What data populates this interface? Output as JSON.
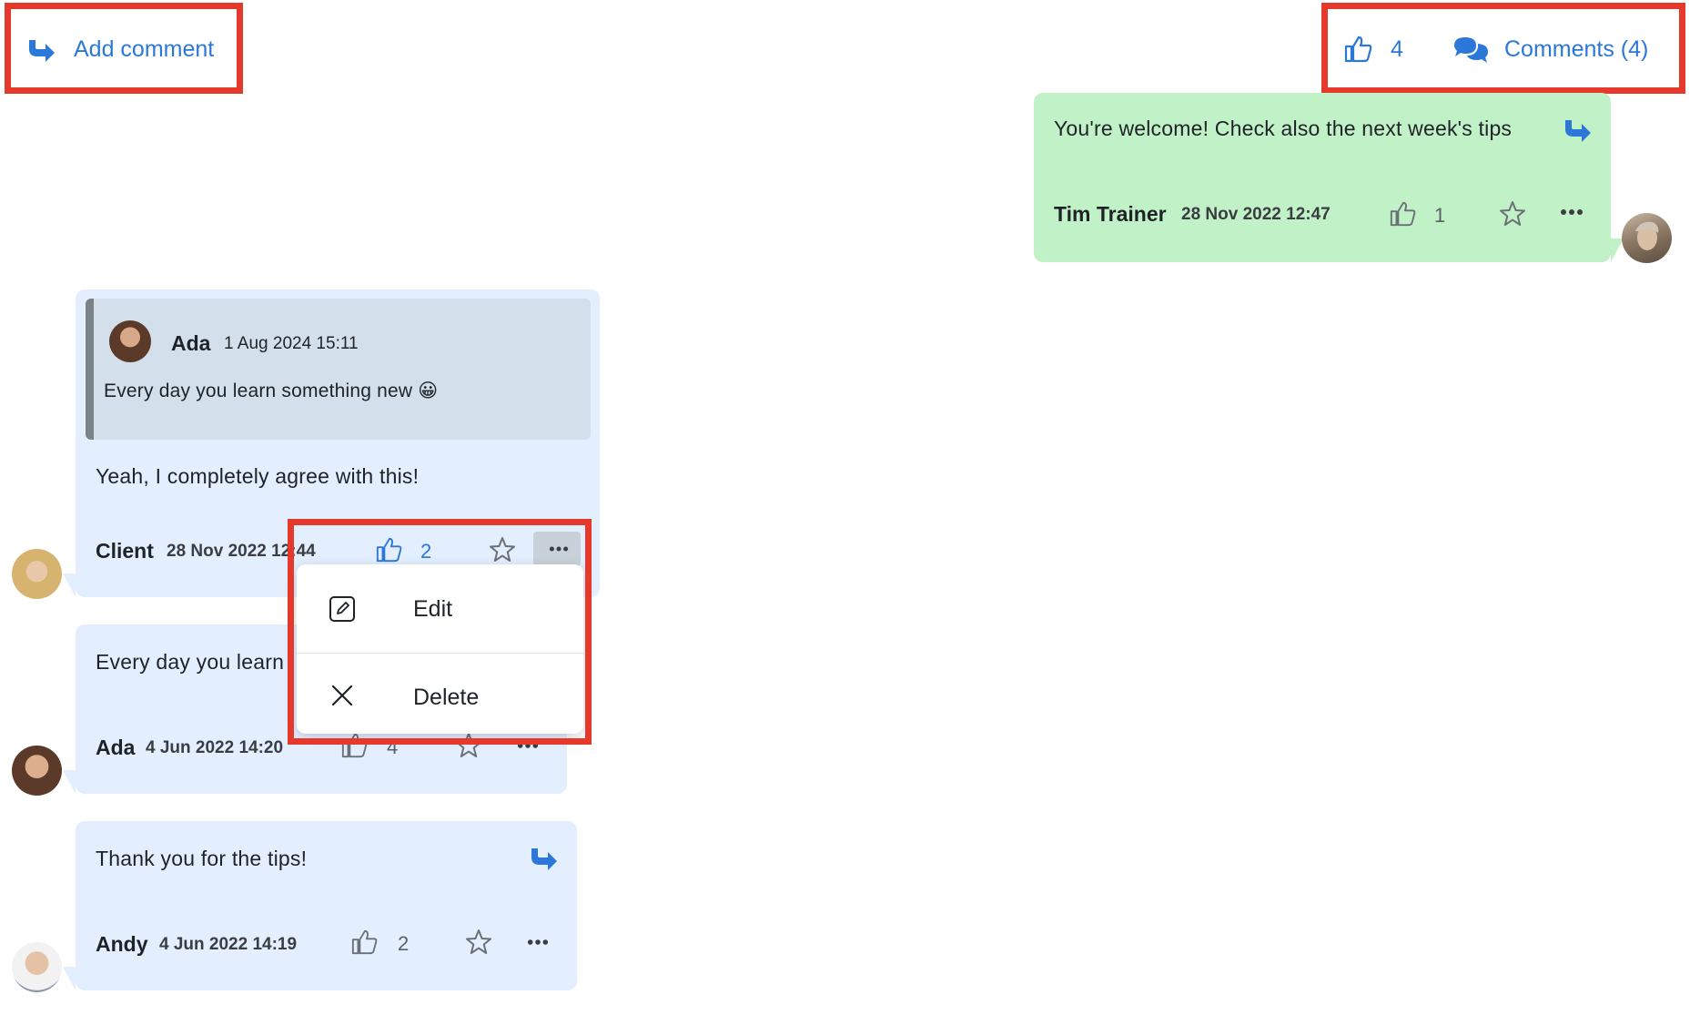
{
  "header": {
    "add_comment_label": "Add comment",
    "likes_count": "4",
    "comments_label": "Comments (4)"
  },
  "colors": {
    "accent": "#2b78d8",
    "highlight": "#e53a2b",
    "bubble_blue": "#e3efff",
    "bubble_green": "#c1f1c6",
    "quote_bg": "#d3dfea"
  },
  "comments": [
    {
      "text": "You're welcome! Check also the next week's tips",
      "author": "Tim Trainer",
      "date": "28 Nov 2022 12:47",
      "likes": "1"
    },
    {
      "quote": {
        "author": "Ada",
        "date": "1 Aug 2024 15:11",
        "text": "Every day you learn something new 😀"
      },
      "text": "Yeah, I completely agree with this!",
      "author": "Client",
      "date": "28 Nov 2022 12:44",
      "likes": "2"
    },
    {
      "text": "Every day you learn",
      "author": "Ada",
      "date": "4 Jun 2022 14:20",
      "likes": "4"
    },
    {
      "text": "Thank you for the tips!",
      "author": "Andy",
      "date": "4 Jun 2022 14:19",
      "likes": "2"
    }
  ],
  "context_menu": {
    "edit_label": "Edit",
    "delete_label": "Delete"
  },
  "icons": [
    "reply-arrow-icon",
    "thumbs-up-icon",
    "comments-icon",
    "star-icon",
    "more-icon",
    "edit-icon",
    "close-icon"
  ]
}
